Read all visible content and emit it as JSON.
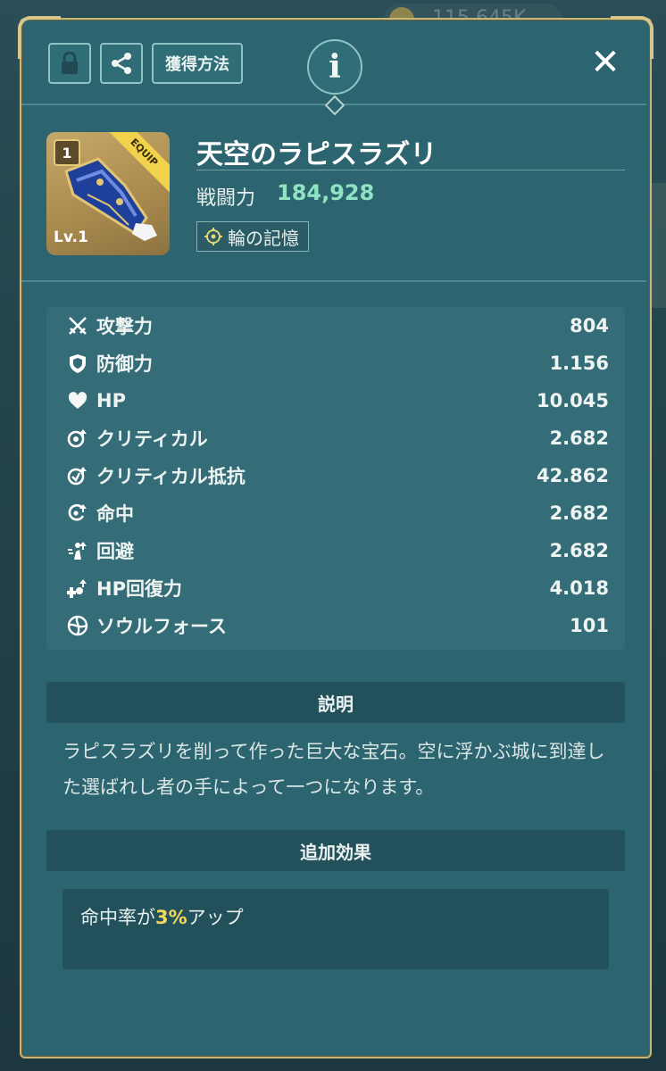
{
  "background": {
    "currency_text": "115,645K"
  },
  "toolbar": {
    "lock_icon": "lock-icon",
    "share_icon": "share-icon",
    "acquire_label": "獲得方法",
    "info_label": "i",
    "close_label": "✕"
  },
  "item": {
    "name": "天空のラピスラズリ",
    "power_label": "戦闘力",
    "power_value": "184,928",
    "tag_label": "輪の記憶",
    "level_label": "Lv.1",
    "badge_number": "1",
    "ribbon_label": "EQUIP"
  },
  "stats": [
    {
      "icon": "crossed-swords-icon",
      "name": "攻撃力",
      "value": "804"
    },
    {
      "icon": "shield-icon",
      "name": "防御力",
      "value": "1.156"
    },
    {
      "icon": "heart-icon",
      "name": "HP",
      "value": "10.045"
    },
    {
      "icon": "critical-icon",
      "name": "クリティカル",
      "value": "2.682"
    },
    {
      "icon": "critical-resist-icon",
      "name": "クリティカル抵抗",
      "value": "42.862"
    },
    {
      "icon": "accuracy-icon",
      "name": "命中",
      "value": "2.682"
    },
    {
      "icon": "evasion-icon",
      "name": "回避",
      "value": "2.682"
    },
    {
      "icon": "hp-recovery-icon",
      "name": "HP回復力",
      "value": "4.018"
    },
    {
      "icon": "soul-force-icon",
      "name": "ソウルフォース",
      "value": "101"
    }
  ],
  "description": {
    "header": "説明",
    "text": "ラピスラズリを削って作った巨大な宝石。空に浮かぶ城に到達した選ばれし者の手によって一つになります。"
  },
  "extra_effect": {
    "header": "追加効果",
    "text_before": "命中率が",
    "highlight": "3%",
    "text_after": "アップ"
  },
  "colors": {
    "panel": "#2c6470",
    "border_gold": "#c9b77a",
    "power_green": "#8fe3c2",
    "highlight_yellow": "#f3d85c"
  }
}
